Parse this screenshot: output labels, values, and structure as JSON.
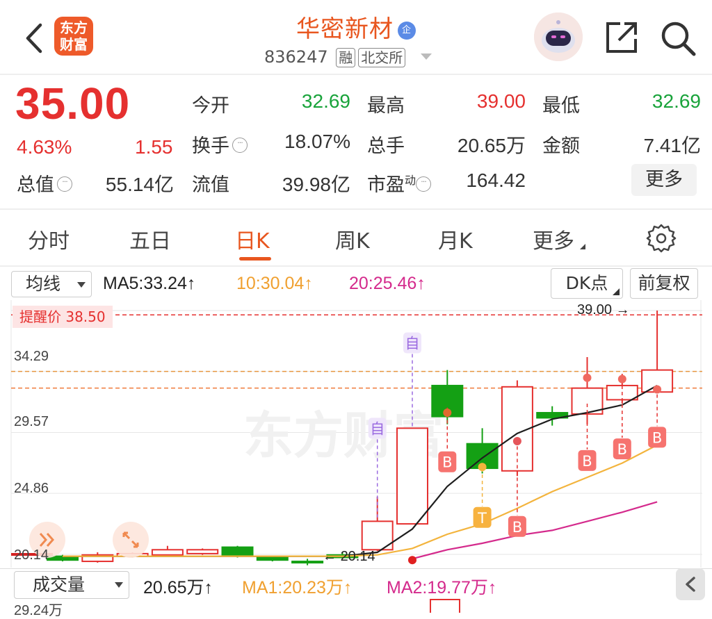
{
  "header": {
    "title": "华密新材",
    "enterprise_badge": "企",
    "code": "836247",
    "tags": [
      "融",
      "北交所"
    ],
    "logo_text_line1": "东方",
    "logo_text_line2": "财富"
  },
  "quote": {
    "price": "35.00",
    "change_pct": "4.63%",
    "change_amt": "1.55",
    "fields": {
      "open_label": "今开",
      "open_value": "32.69",
      "high_label": "最高",
      "high_value": "39.00",
      "low_label": "最低",
      "low_value": "32.69",
      "turnover_label": "换手",
      "turnover_value": "18.07%",
      "volume_label": "总手",
      "volume_value": "20.65万",
      "amount_label": "金额",
      "amount_value": "7.41亿",
      "mktcap_label": "总值",
      "mktcap_value": "55.14亿",
      "float_label": "流值",
      "float_value": "39.98亿",
      "pe_label": "市盈",
      "pe_superscript": "动",
      "pe_value": "164.42"
    },
    "more_button": "更多"
  },
  "tabs": [
    "分时",
    "五日",
    "日K",
    "周K",
    "月K",
    "更多"
  ],
  "active_tab": "日K",
  "chart_toolbar": {
    "indicator_select": "均线",
    "ma5": "MA5:33.24↑",
    "ma10": "10:30.04↑",
    "ma20": "20:25.46↑",
    "dk_button": "DK点",
    "fq_button": "前复权"
  },
  "chart_labels": {
    "alert": "提醒价 38.50",
    "y_ticks": [
      "39.00",
      "34.29",
      "29.57",
      "24.86",
      "20.14"
    ],
    "high_marker": "39.00",
    "low_marker": "20.14",
    "self_marker": "自",
    "buy_marker": "B",
    "t_marker": "T",
    "watermark": "东方财富"
  },
  "chart_data": {
    "type": "candlestick",
    "ylim": [
      20.14,
      39.0
    ],
    "y_ticks": [
      39.0,
      34.29,
      29.57,
      24.86,
      20.14
    ],
    "alert_price": 38.5,
    "candles": [
      {
        "o": 20.0,
        "c": 19.7,
        "h": 20.1,
        "l": 19.6,
        "dir": "down"
      },
      {
        "o": 19.6,
        "c": 20.1,
        "h": 20.3,
        "l": 19.5,
        "dir": "up"
      },
      {
        "o": 20.0,
        "c": 20.2,
        "h": 20.3,
        "l": 19.9,
        "dir": "up"
      },
      {
        "o": 20.1,
        "c": 20.5,
        "h": 20.8,
        "l": 20.0,
        "dir": "up"
      },
      {
        "o": 20.2,
        "c": 20.5,
        "h": 20.6,
        "l": 20.1,
        "dir": "up"
      },
      {
        "o": 20.7,
        "c": 20.0,
        "h": 20.8,
        "l": 19.9,
        "dir": "down"
      },
      {
        "o": 19.9,
        "c": 19.7,
        "h": 20.0,
        "l": 19.6,
        "dir": "down"
      },
      {
        "o": 19.6,
        "c": 19.5,
        "h": 19.8,
        "l": 19.3,
        "dir": "down"
      },
      {
        "o": 20.1,
        "c": 19.9,
        "h": 20.3,
        "l": 19.8,
        "dir": "down"
      },
      {
        "o": 20.5,
        "c": 22.7,
        "h": 24.6,
        "l": 20.4,
        "dir": "up"
      },
      {
        "o": 22.5,
        "c": 29.9,
        "h": 29.9,
        "l": 22.5,
        "dir": "up"
      },
      {
        "o": 33.2,
        "c": 30.8,
        "h": 34.4,
        "l": 30.2,
        "dir": "down"
      },
      {
        "o": 28.7,
        "c": 26.8,
        "h": 29.9,
        "l": 26.4,
        "dir": "down"
      },
      {
        "o": 26.6,
        "c": 33.1,
        "h": 33.6,
        "l": 26.2,
        "dir": "up"
      },
      {
        "o": 31.1,
        "c": 30.7,
        "h": 31.6,
        "l": 30.1,
        "dir": "down"
      },
      {
        "o": 31.0,
        "c": 33.0,
        "h": 35.4,
        "l": 30.2,
        "dir": "up"
      },
      {
        "o": 32.1,
        "c": 33.2,
        "h": 34.1,
        "l": 31.8,
        "dir": "up"
      },
      {
        "o": 32.7,
        "c": 34.4,
        "h": 39.0,
        "l": 32.7,
        "dir": "up"
      }
    ],
    "series": [
      {
        "name": "MA5",
        "values": [
          20.0,
          20.0,
          20.0,
          20.0,
          20.0,
          20.0,
          20.0,
          20.0,
          20.0,
          20.3,
          22.1,
          25.4,
          27.6,
          29.5,
          30.6,
          31.1,
          31.7,
          33.2
        ]
      },
      {
        "name": "MA10",
        "values": [
          20.0,
          20.0,
          20.0,
          20.0,
          20.0,
          20.0,
          20.0,
          20.0,
          20.0,
          20.1,
          20.6,
          21.7,
          22.5,
          23.7,
          25.0,
          26.1,
          27.2,
          28.6
        ]
      },
      {
        "name": "MA20",
        "values": [
          null,
          null,
          null,
          null,
          null,
          null,
          null,
          null,
          null,
          null,
          19.8,
          20.5,
          21.0,
          21.6,
          22.0,
          22.7,
          23.4,
          24.2
        ]
      }
    ]
  },
  "volume_toolbar": {
    "select": "成交量",
    "vol": "20.65万↑",
    "ma1": "MA1:20.23万↑",
    "ma2": "MA2:19.77万↑",
    "y_top": "29.24万"
  }
}
